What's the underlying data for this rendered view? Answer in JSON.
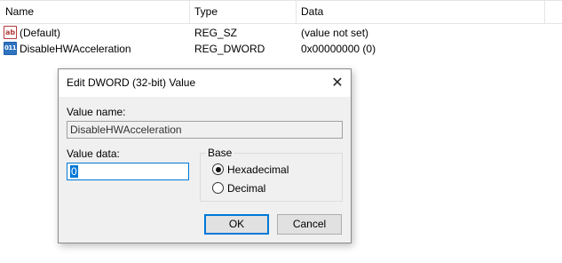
{
  "list": {
    "columns": [
      "Name",
      "Type",
      "Data"
    ],
    "rows": [
      {
        "icon": "string-value-icon",
        "icon_text": "ab",
        "name": "(Default)",
        "type": "REG_SZ",
        "data": "(value not set)"
      },
      {
        "icon": "dword-value-icon",
        "icon_text": "011",
        "name": "DisableHWAcceleration",
        "type": "REG_DWORD",
        "data": "0x00000000 (0)"
      }
    ]
  },
  "dialog": {
    "title": "Edit DWORD (32-bit) Value",
    "close_glyph": "✕",
    "value_name_label": "Value name:",
    "value_name": "DisableHWAcceleration",
    "value_data_label": "Value data:",
    "value_data": "0",
    "base_label": "Base",
    "base_options": [
      "Hexadecimal",
      "Decimal"
    ],
    "base_selected": "Hexadecimal",
    "ok_label": "OK",
    "cancel_label": "Cancel"
  }
}
